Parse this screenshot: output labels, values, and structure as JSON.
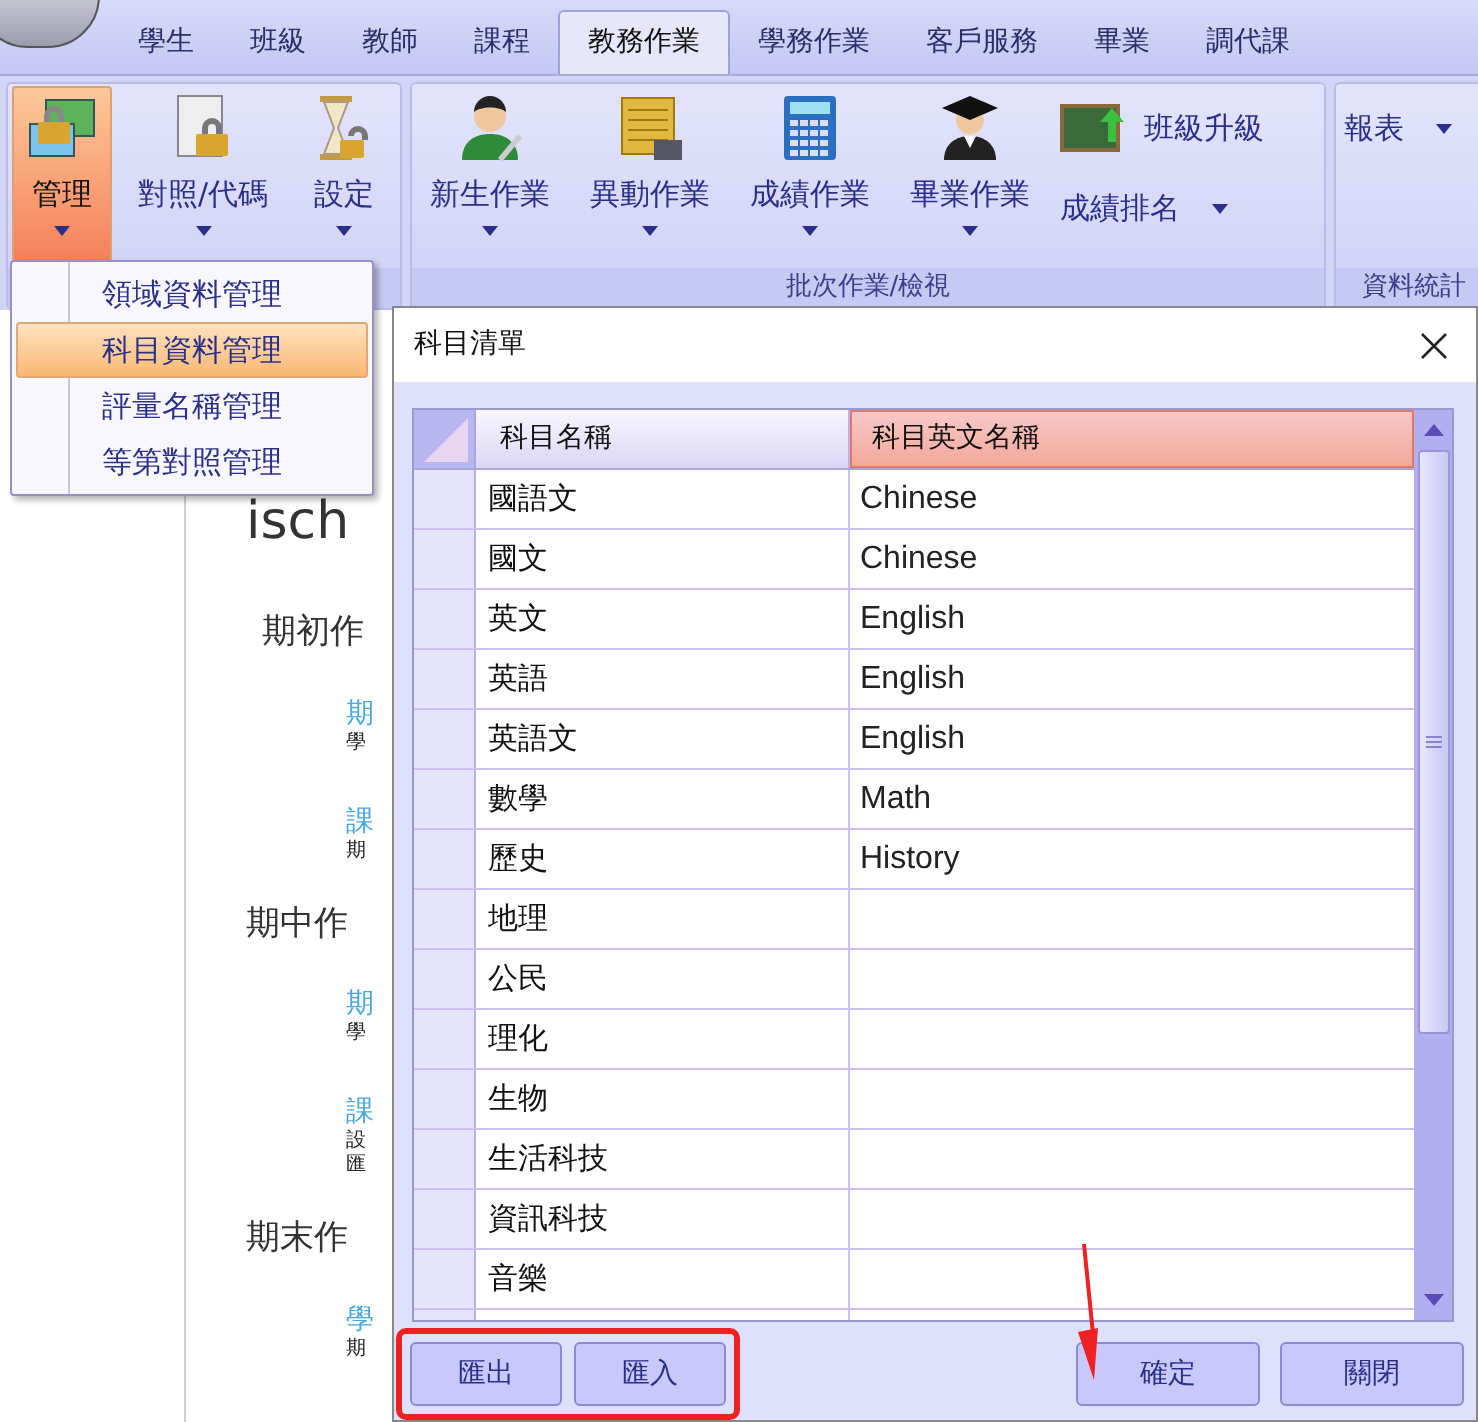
{
  "tabs": [
    {
      "label": "學生",
      "selected": false
    },
    {
      "label": "班級",
      "selected": false
    },
    {
      "label": "教師",
      "selected": false
    },
    {
      "label": "課程",
      "selected": false
    },
    {
      "label": "教務作業",
      "selected": true
    },
    {
      "label": "學務作業",
      "selected": false
    },
    {
      "label": "客戶服務",
      "selected": false
    },
    {
      "label": "畢業",
      "selected": false
    },
    {
      "label": "調代課",
      "selected": false
    }
  ],
  "ribbon": {
    "groups": [
      {
        "buttons": [
          {
            "label": "管理",
            "kind": "large",
            "selected": true
          },
          {
            "label": "對照/代碼",
            "kind": "large",
            "selected": false
          },
          {
            "label": "設定",
            "kind": "large",
            "selected": false
          }
        ]
      },
      {
        "label": "批次作業/檢視",
        "buttons": [
          {
            "label": "新生作業",
            "kind": "large",
            "selected": false
          },
          {
            "label": "異動作業",
            "kind": "large",
            "selected": false
          },
          {
            "label": "成績作業",
            "kind": "large",
            "selected": false
          },
          {
            "label": "畢業作業",
            "kind": "large",
            "selected": false
          },
          {
            "label": "班級升級",
            "kind": "small",
            "selected": false
          },
          {
            "label": "成績排名",
            "kind": "small-dropdown",
            "selected": false
          }
        ]
      },
      {
        "label": "資料統計",
        "buttons": [
          {
            "label": "報表",
            "kind": "small-dropdown",
            "selected": false
          }
        ]
      }
    ]
  },
  "dropdown_menu": {
    "items": [
      {
        "label": "領域資料管理",
        "selected": false
      },
      {
        "label": "科目資料管理",
        "selected": true
      },
      {
        "label": "評量名稱管理",
        "selected": false
      },
      {
        "label": "等第對照管理",
        "selected": false
      }
    ]
  },
  "background": {
    "heading": "isch",
    "sections": [
      {
        "title": "期初作",
        "links": [
          {
            "link": "期",
            "desc": [
              "學"
            ]
          },
          {
            "link": "課",
            "desc": [
              "期"
            ]
          }
        ]
      },
      {
        "title": "期中作",
        "links": [
          {
            "link": "期",
            "desc": [
              "學"
            ]
          },
          {
            "link": "課",
            "desc": [
              "設",
              "匯"
            ]
          }
        ]
      },
      {
        "title": "期末作",
        "links": [
          {
            "link": "學",
            "desc": [
              "期"
            ]
          }
        ]
      }
    ]
  },
  "dialog": {
    "title": "科目清單",
    "columns": [
      "科目名稱",
      "科目英文名稱"
    ],
    "rows": [
      {
        "name": "國語文",
        "english": "Chinese"
      },
      {
        "name": "國文",
        "english": "Chinese"
      },
      {
        "name": "英文",
        "english": "English"
      },
      {
        "name": "英語",
        "english": "English"
      },
      {
        "name": "英語文",
        "english": "English"
      },
      {
        "name": "數學",
        "english": "Math"
      },
      {
        "name": "歷史",
        "english": "History"
      },
      {
        "name": "地理"
      },
      {
        "name": "公民"
      },
      {
        "name": "理化"
      },
      {
        "name": "生物"
      },
      {
        "name": "生活科技"
      },
      {
        "name": "資訊科技"
      },
      {
        "name": "音樂"
      }
    ],
    "left_buttons": [
      "匯出",
      "匯入"
    ],
    "right_buttons": [
      "確定",
      "關閉"
    ]
  }
}
